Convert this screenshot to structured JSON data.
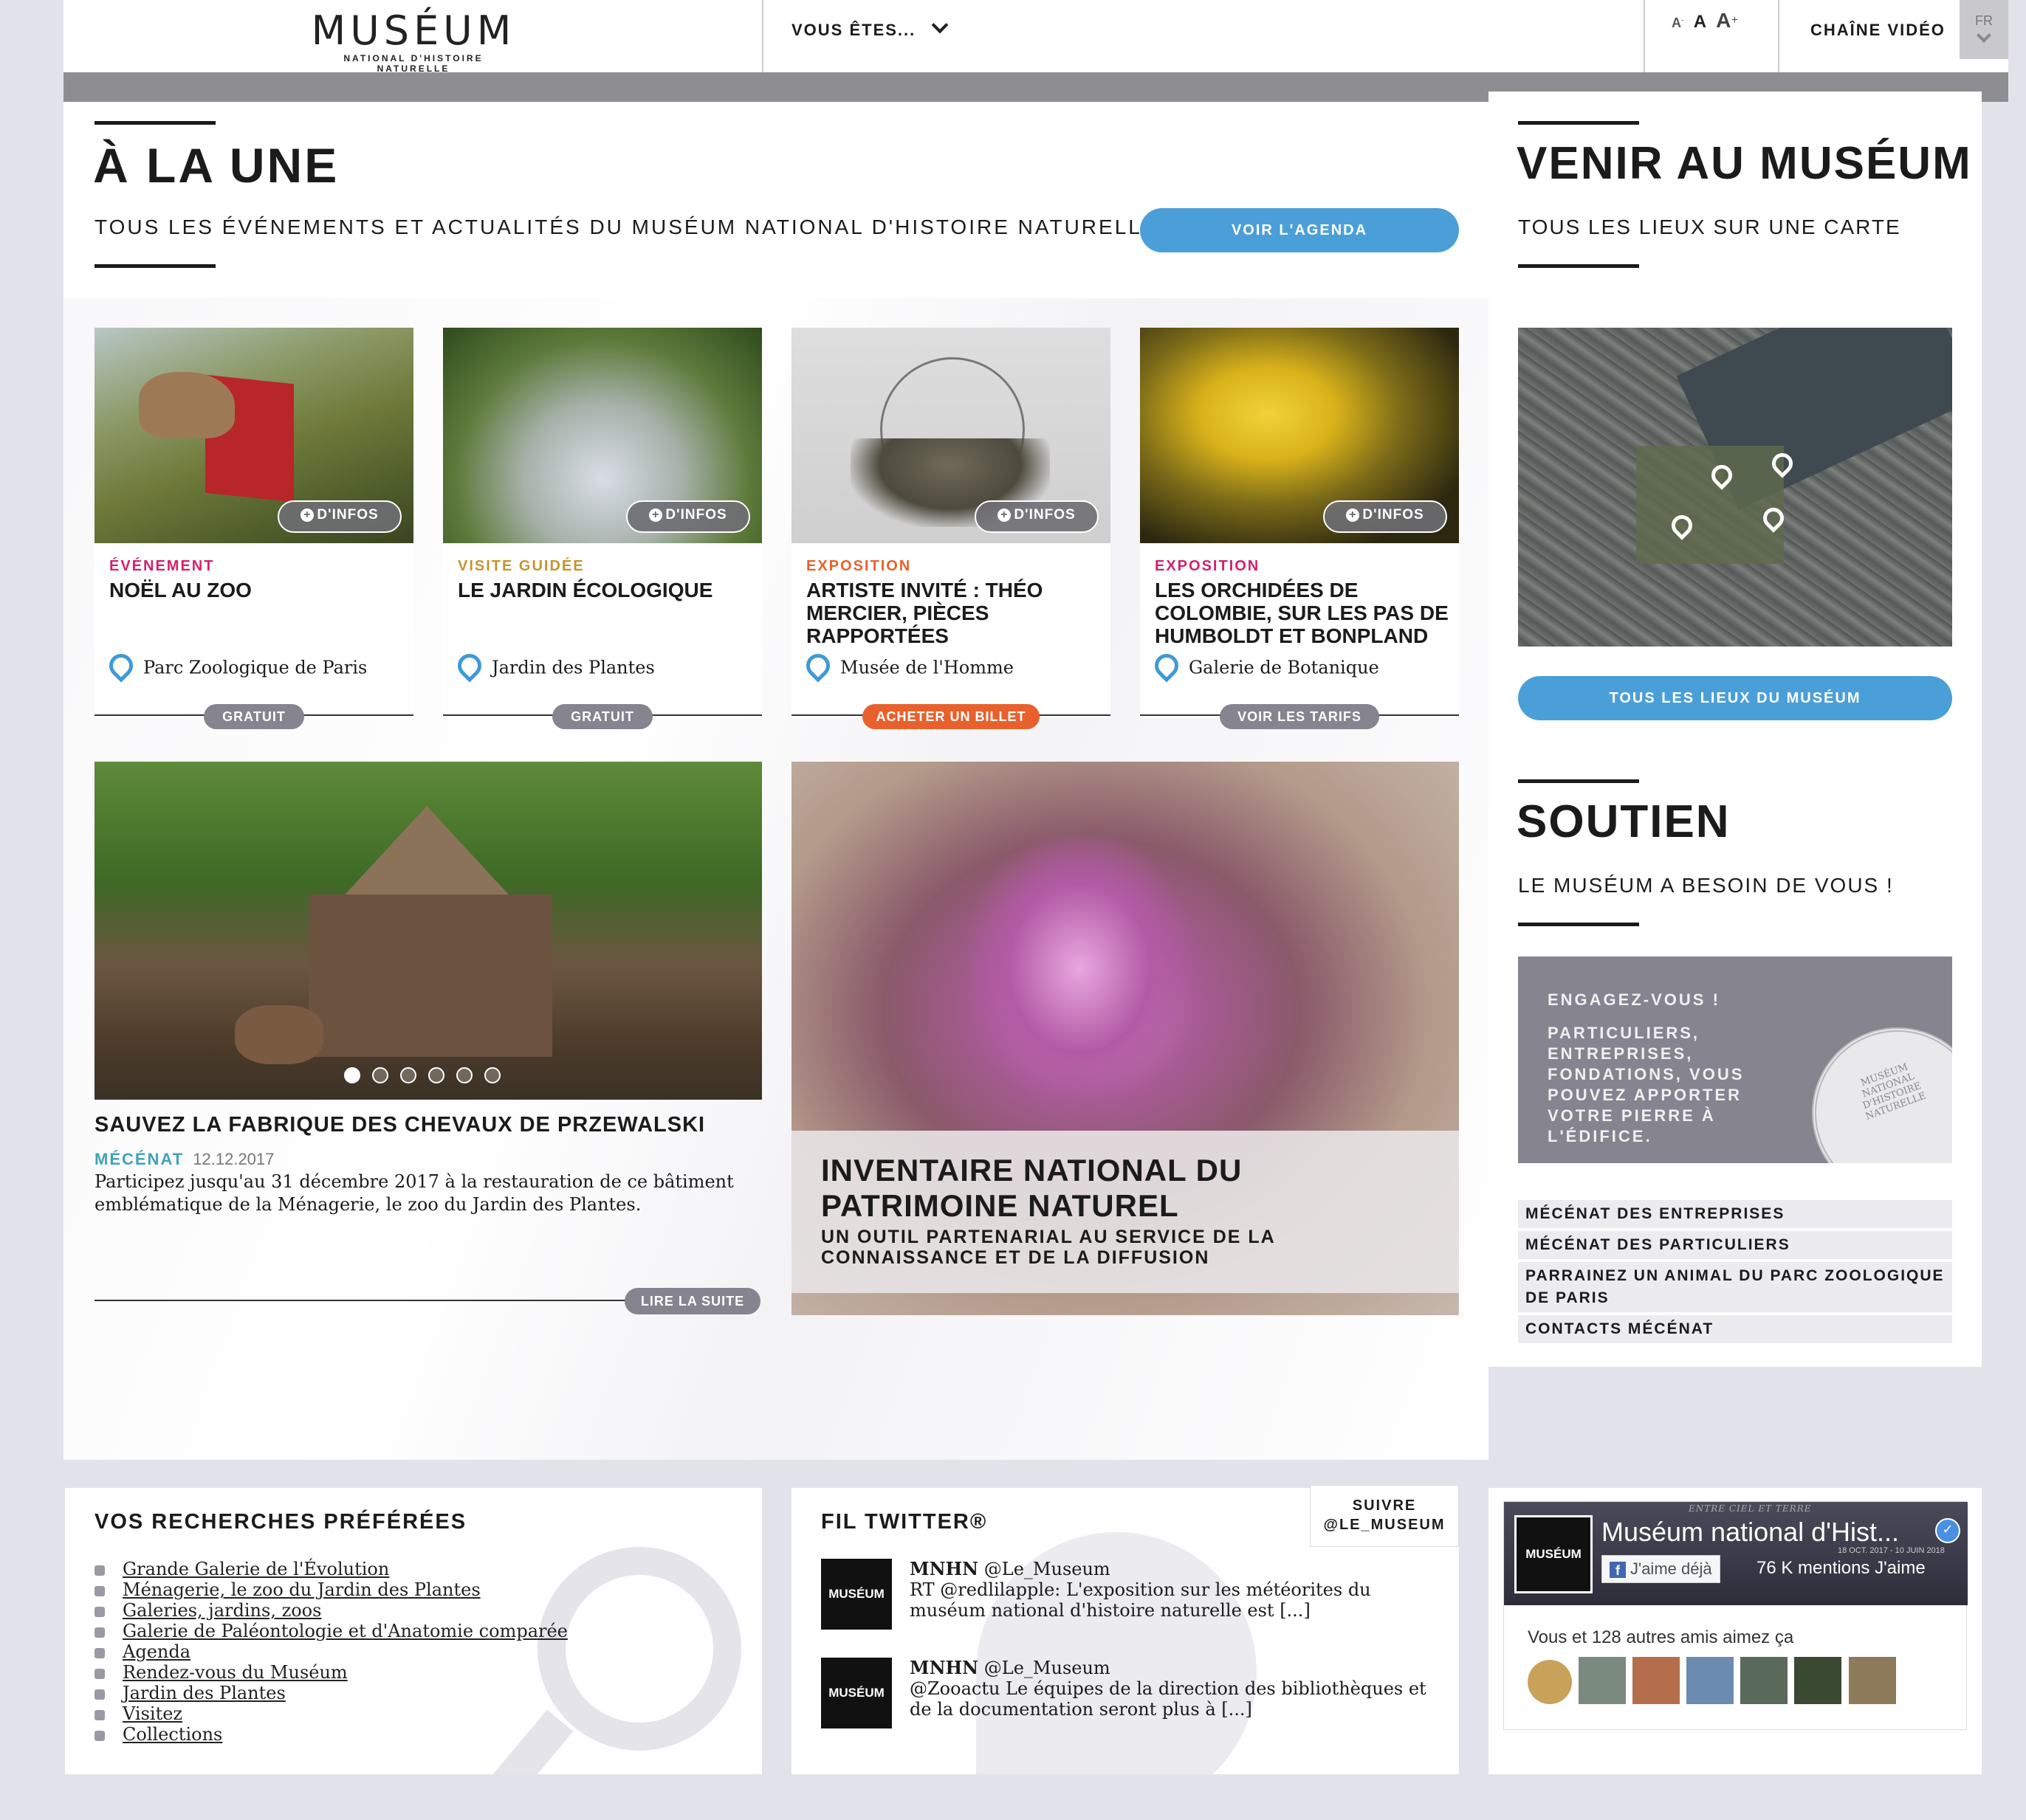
{
  "header": {
    "logo_title": "MUSÉUM",
    "logo_subtitle": "NATIONAL D'HISTOIRE NATURELLE",
    "vous_etes": "VOUS ÊTES...",
    "font_small": "A",
    "font_medium": "A",
    "font_large": "A",
    "chaine_video": "CHAÎNE VIDÉO",
    "lang": "FR"
  },
  "une": {
    "title": "À LA UNE",
    "subtitle": "TOUS LES ÉVÉNEMENTS ET ACTUALITÉS DU MUSÉUM NATIONAL D'HISTOIRE NATURELLE",
    "agenda_button": "VOIR L'AGENDA"
  },
  "cards": [
    {
      "infos": "D'INFOS",
      "category": "ÉVÉNEMENT",
      "title": "NOËL AU ZOO",
      "location": "Parc Zoologique de Paris",
      "action": "GRATUIT"
    },
    {
      "infos": "D'INFOS",
      "category": "VISITE GUIDÉE",
      "title": "LE JARDIN ÉCOLOGIQUE",
      "location": "Jardin des Plantes",
      "action": "GRATUIT"
    },
    {
      "infos": "D'INFOS",
      "category": "EXPOSITION",
      "title": "ARTISTE INVITÉ : THÉO MERCIER, PIÈCES RAPPORTÉES",
      "location": "Musée de l'Homme",
      "action": "ACHETER UN BILLET"
    },
    {
      "infos": "D'INFOS",
      "category": "EXPOSITION",
      "title": "LES ORCHIDÉES DE COLOMBIE, SUR LES PAS DE HUMBOLDT ET BONPLAND",
      "location": "Galerie de Botanique",
      "action": "VOIR LES TARIFS"
    }
  ],
  "feature": {
    "title": "SAUVEZ LA FABRIQUE DES CHEVAUX DE PRZEWALSKI",
    "category": "MÉCÉNAT",
    "date": "12.12.2017",
    "text": "Participez jusqu'au 31 décembre 2017 à la restauration de ce bâtiment emblématique de la Ménagerie, le zoo du Jardin des Plantes.",
    "read_more": "LIRE LA SUITE",
    "slide_count": 6,
    "active_slide": 1
  },
  "inventaire": {
    "title": "INVENTAIRE NATIONAL DU PATRIMOINE NATUREL",
    "subtitle": "UN OUTIL PARTENARIAL AU SERVICE DE LA CONNAISSANCE ET DE LA DIFFUSION"
  },
  "venir": {
    "title": "VENIR AU MUSÉUM",
    "subtitle": "TOUS LES LIEUX SUR UNE CARTE",
    "button": "TOUS LES LIEUX DU MUSÉUM"
  },
  "soutien": {
    "title": "SOUTIEN",
    "subtitle": "LE MUSÉUM A BESOIN DE VOUS !",
    "banner_title": "ENGAGEZ-VOUS !",
    "banner_text": "PARTICULIERS, ENTREPRISES, FONDATIONS, VOUS POUVEZ APPORTER VOTRE PIERRE À L'ÉDIFICE.",
    "seal_text": "MUSÉUM NATIONAL D'HISTOIRE NATURELLE",
    "links": [
      "MÉCÉNAT DES ENTREPRISES",
      "MÉCÉNAT DES PARTICULIERS",
      "PARRAINEZ UN ANIMAL DU PARC ZOOLOGIQUE DE PARIS",
      "CONTACTS MÉCÉNAT"
    ]
  },
  "recherches": {
    "title": "VOS RECHERCHES PRÉFÉRÉES",
    "items": [
      "Grande Galerie de l'Évolution",
      "Ménagerie, le zoo du Jardin des Plantes",
      "Galeries, jardins, zoos",
      "Galerie de Paléontologie et d'Anatomie comparée",
      "Agenda",
      "Rendez-vous du Muséum",
      "Jardin des Plantes",
      "Visitez",
      "Collections"
    ]
  },
  "twitter": {
    "title": "FIL TWITTER®",
    "follow": "SUIVRE\n@LE_MUSEUM",
    "avatar_text": "MUSÉUM",
    "tweets": [
      {
        "name": "MNHN",
        "handle": "@Le_Museum",
        "text": "RT @redlilapple: L'exposition sur les météorites du muséum national d'histoire naturelle est [...]"
      },
      {
        "name": "MNHN",
        "handle": "@Le_Museum",
        "text": "@Zooactu Le équipes de la direction des bibliothèques et de la documentation seront plus à [...]"
      }
    ]
  },
  "facebook": {
    "page_name": "Muséum national d'Hist...",
    "logo_text": "MUSÉUM",
    "cover_overlay": "ENTRE CIEL ET TERRE",
    "cover_dates": "18 OCT. 2017 - 10 JUIN 2018",
    "like_button": "J'aime déjà",
    "likes": "76 K mentions J'aime",
    "friends_text": "Vous et 128 autres amis aimez ça"
  },
  "colors": {
    "blue": "#4b9fd9",
    "orange": "#e8612c",
    "grey_pill": "#85848f",
    "pink": "#d4206e",
    "gold": "#c9932e",
    "teal": "#3fa3b8"
  }
}
